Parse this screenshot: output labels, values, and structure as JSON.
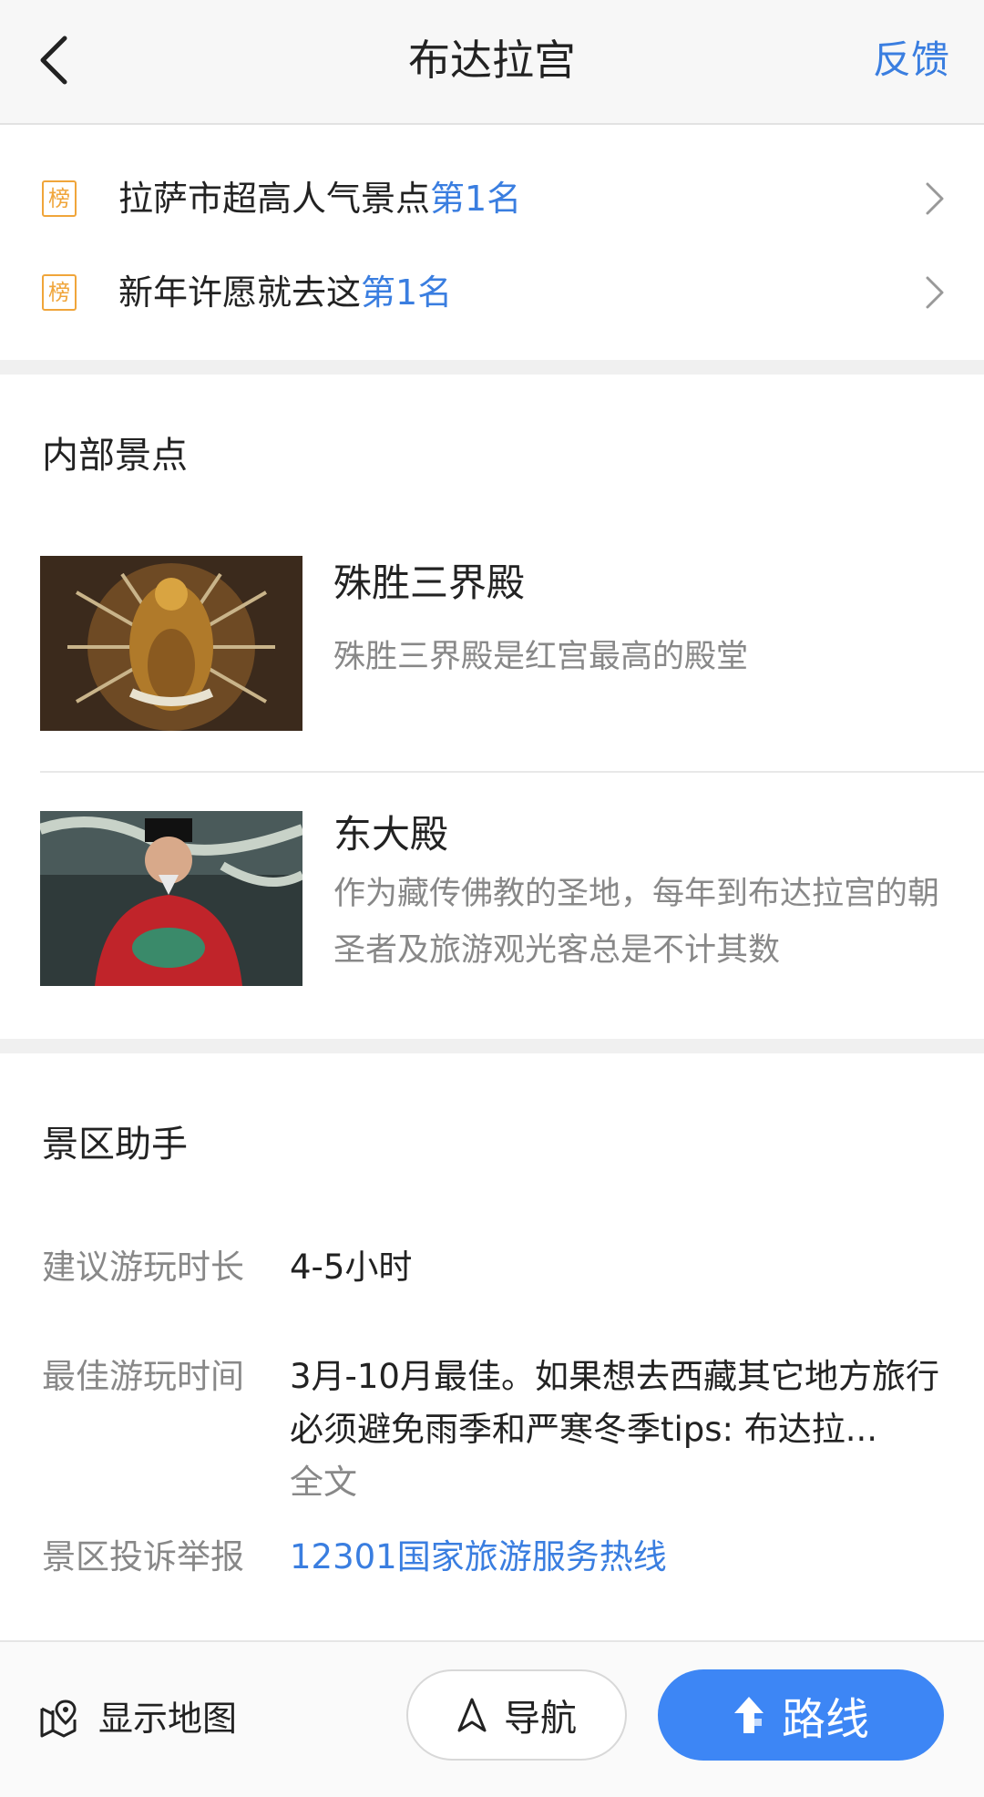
{
  "header": {
    "title": "布达拉宫",
    "feedback": "反馈"
  },
  "ranks": [
    {
      "badge": "榜",
      "text": "拉萨市超高人气景点",
      "rank": "第1名"
    },
    {
      "badge": "榜",
      "text": "新年许愿就去这",
      "rank": "第1名"
    }
  ],
  "inner_spots": {
    "title": "内部景点",
    "items": [
      {
        "name": "殊胜三界殿",
        "desc": "殊胜三界殿是红宫最高的殿堂"
      },
      {
        "name": "东大殿",
        "desc": "作为藏传佛教的圣地，每年到布达拉宫的朝圣者及旅游观光客总是不计其数"
      }
    ]
  },
  "assistant": {
    "title": "景区助手",
    "rows": [
      {
        "label": "建议游玩时长",
        "value": "4-5小时"
      },
      {
        "label": "最佳游玩时间",
        "value": "3月-10月最佳。如果想去西藏其它地方旅行必须避免雨季和严寒冬季tips: 布达拉...",
        "more": "全文"
      },
      {
        "label": "景区投诉举报",
        "value": "12301国家旅游服务热线"
      }
    ]
  },
  "bottom_bar": {
    "map_label": "显示地图",
    "nav_label": "导航",
    "route_label": "路线"
  },
  "colors": {
    "accent": "#3a7ee0",
    "badge": "#f0a53a",
    "route_button": "#3d86f5"
  }
}
